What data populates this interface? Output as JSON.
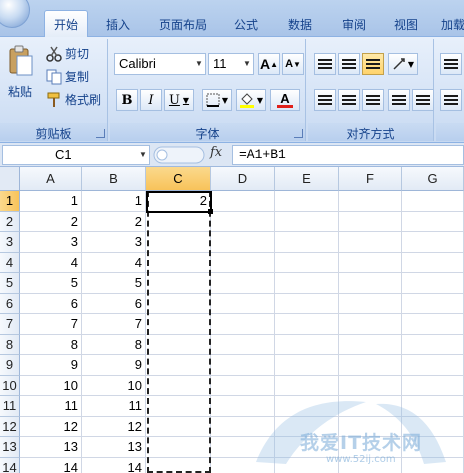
{
  "tabs": [
    {
      "label": "开始",
      "active": true
    },
    {
      "label": "插入"
    },
    {
      "label": "页面布局"
    },
    {
      "label": "公式"
    },
    {
      "label": "数据"
    },
    {
      "label": "审阅"
    },
    {
      "label": "视图"
    },
    {
      "label": "加载"
    }
  ],
  "clipboard": {
    "paste_label": "粘贴",
    "cut_label": "剪切",
    "copy_label": "复制",
    "format_painter_label": "格式刷",
    "group_label": "剪贴板"
  },
  "font": {
    "name": "Calibri",
    "size": "11",
    "grow_label": "A",
    "shrink_label": "A",
    "bold_label": "B",
    "italic_label": "I",
    "underline_label": "U",
    "font_color_label": "A",
    "group_label": "字体"
  },
  "alignment": {
    "group_label": "对齐方式"
  },
  "formula_bar": {
    "name_box": "C1",
    "fx_label": "fx",
    "formula": "=A1+B1"
  },
  "sheet": {
    "columns": [
      "A",
      "B",
      "C",
      "D",
      "E",
      "F",
      "G"
    ],
    "selected_column": "C",
    "selected_row": 1,
    "rows": [
      {
        "n": "1",
        "A": "1",
        "B": "1",
        "C": "2"
      },
      {
        "n": "2",
        "A": "2",
        "B": "2",
        "C": ""
      },
      {
        "n": "3",
        "A": "3",
        "B": "3",
        "C": ""
      },
      {
        "n": "4",
        "A": "4",
        "B": "4",
        "C": ""
      },
      {
        "n": "5",
        "A": "5",
        "B": "5",
        "C": ""
      },
      {
        "n": "6",
        "A": "6",
        "B": "6",
        "C": ""
      },
      {
        "n": "7",
        "A": "7",
        "B": "7",
        "C": ""
      },
      {
        "n": "8",
        "A": "8",
        "B": "8",
        "C": ""
      },
      {
        "n": "9",
        "A": "9",
        "B": "9",
        "C": ""
      },
      {
        "n": "10",
        "A": "10",
        "B": "10",
        "C": ""
      },
      {
        "n": "11",
        "A": "11",
        "B": "11",
        "C": ""
      },
      {
        "n": "12",
        "A": "12",
        "B": "12",
        "C": ""
      },
      {
        "n": "13",
        "A": "13",
        "B": "13",
        "C": ""
      },
      {
        "n": "14",
        "A": "14",
        "B": "14",
        "C": ""
      }
    ]
  },
  "watermark": {
    "text": "我爱IT技术网",
    "url": "www.52ij.com"
  },
  "colors": {
    "accent": "#15428b",
    "selected_header": "#f8c35a"
  }
}
